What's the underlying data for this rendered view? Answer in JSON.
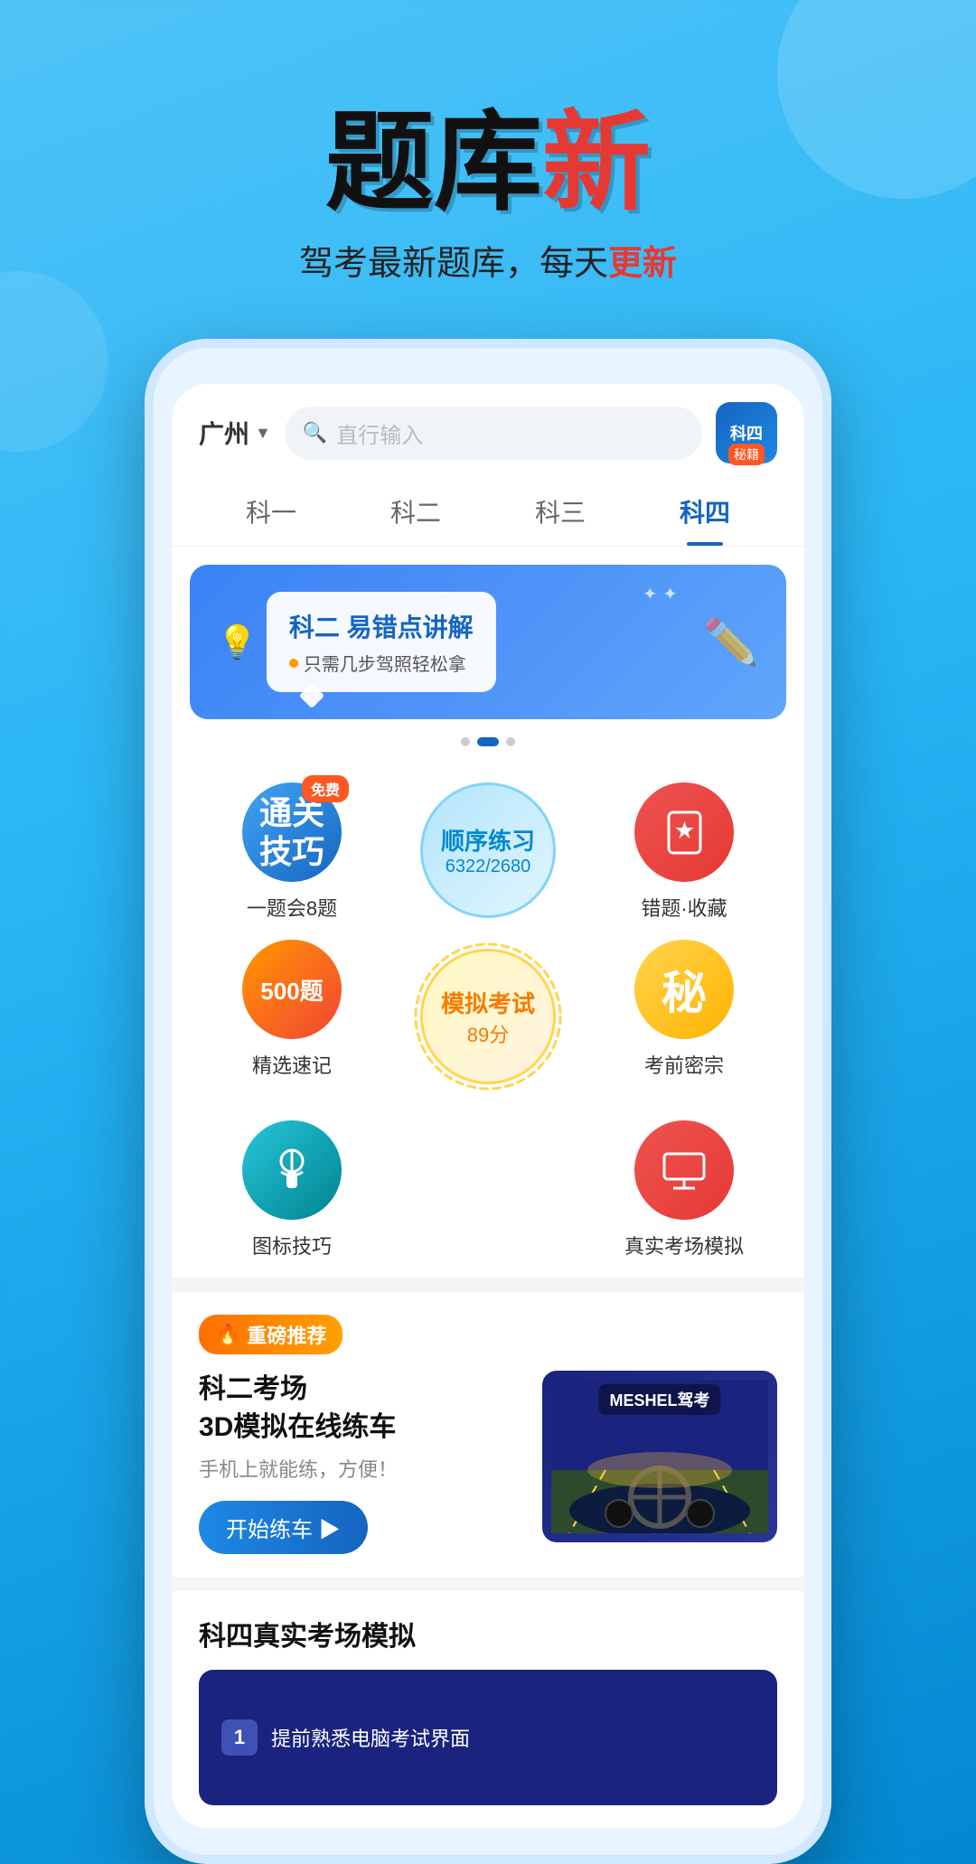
{
  "app": {
    "title": "题库新",
    "title_black": "题库",
    "title_red": "新",
    "subtitle": "驾考最新题库，每天",
    "subtitle_red": "更新"
  },
  "phone": {
    "city": "广州",
    "search_placeholder": "直行输入",
    "kesi_label": "科四",
    "kesi_sublabel": "秘籍"
  },
  "nav": {
    "tabs": [
      "科一",
      "科二",
      "科三",
      "科四"
    ],
    "active": 3
  },
  "banner": {
    "title": "科二 易错点讲解",
    "subtitle": "只需几步驾照轻松拿"
  },
  "features": {
    "row1": [
      {
        "id": "tongguan",
        "label": "一题会8题",
        "sublabel": "通关\n技巧",
        "free": true
      },
      {
        "id": "shunxu",
        "label": "顺序练习",
        "count": "6322/2680"
      },
      {
        "id": "cuoti",
        "label": "错题·收藏"
      }
    ],
    "row2": [
      {
        "id": "jingxuan",
        "label": "精选速记"
      },
      {
        "id": "moni",
        "label": "模拟考试",
        "score": "89分"
      },
      {
        "id": "kaomian",
        "label": "考前密宗"
      }
    ],
    "row3": [
      {
        "id": "tubiao",
        "label": "图标技巧"
      },
      {
        "id": "moni2",
        "label": ""
      },
      {
        "id": "zhenshi",
        "label": "真实考场模拟"
      }
    ]
  },
  "recommend": {
    "badge": "重磅推荐",
    "title": "科二考场\n3D模拟在线练车",
    "desc": "手机上就能练，方便！",
    "btn": "开始练车 ▶",
    "car_brand": "MESHEL驾考"
  },
  "section4": {
    "title": "科四真实考场模拟",
    "item1": "1  提前熟悉电脑考试界面"
  }
}
